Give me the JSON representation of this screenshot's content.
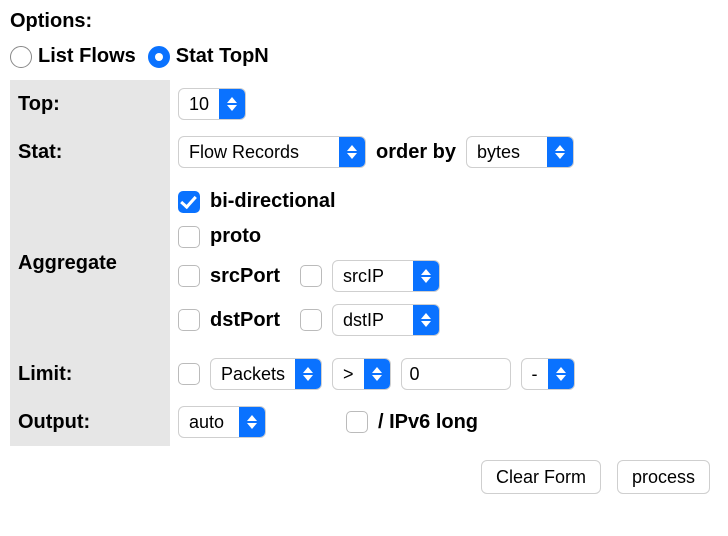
{
  "section_title": "Options:",
  "mode": {
    "list_label": "List Flows",
    "stat_label": "Stat TopN",
    "selected": "stat"
  },
  "top": {
    "label": "Top:",
    "value": "10"
  },
  "stat": {
    "label": "Stat:",
    "value": "Flow Records",
    "order_label": "order by",
    "order_value": "bytes"
  },
  "aggregate": {
    "label": "Aggregate",
    "bidir_label": "bi-directional",
    "bidir_checked": true,
    "proto_label": "proto",
    "proto_checked": false,
    "srcport_label": "srcPort",
    "srcport_checked": false,
    "srcip_checked": false,
    "srcip_value": "srcIP",
    "dstport_label": "dstPort",
    "dstport_checked": false,
    "dstip_checked": false,
    "dstip_value": "dstIP"
  },
  "limit": {
    "label": "Limit:",
    "enabled_checked": false,
    "field_value": "Packets",
    "op_value": ">",
    "threshold_value": "0",
    "unit_value": "-"
  },
  "output": {
    "label": "Output:",
    "value": "auto",
    "ipv6_checked": false,
    "ipv6_label": "/ IPv6 long"
  },
  "buttons": {
    "clear_label": "Clear Form",
    "process_label": "process"
  }
}
